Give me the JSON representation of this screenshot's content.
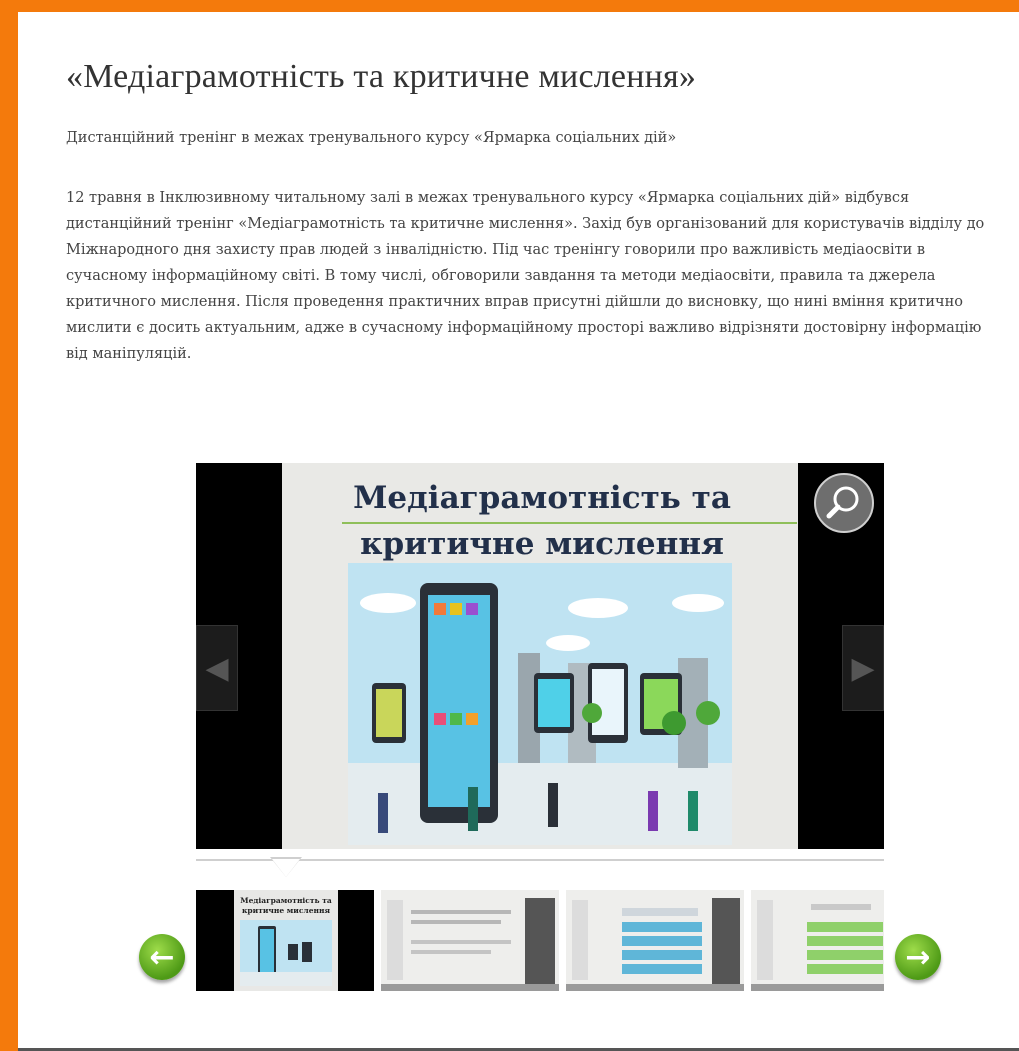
{
  "article": {
    "title": "«Медіаграмотність та критичне мислення»",
    "subtitle": "Дистанційний тренінг в межах тренувального курсу «Ярмарка соціальних дій»",
    "body": "12 травня в Інклюзивному читальному залі в межах тренувального курсу «Ярмарка соціальних дій» відбувся дистанційний тренінг «Медіаграмотність та критичне мислення». Захід був організований для користувачів відділу до Міжнародного дня захисту прав людей з інвалідністю. Під час тренінгу говорили про важливість медіаосвіти в сучасному інформаційному світі. В тому числі, обговорили завдання та методи медіаосвіти, правила та джерела критичного мислення. Після проведення практичних вправ присутні дійшли до висновку, що нині вміння критично мислити є досить актуальним, адже в сучасному інформаційному просторі важливо відрізняти достовірну інформацію від маніпуляцій."
  },
  "gallery": {
    "slide_title": "Медіаграмотність та критичне мислення",
    "prev_icon": "◀",
    "next_icon": "▶",
    "zoom_icon": "magnifier-icon",
    "thumb_active_title": "Медіаграмотність та критичне мислення",
    "thumb_prev_icon": "←",
    "thumb_next_icon": "→"
  },
  "colors": {
    "frame": "#f47a0c",
    "arrow_green": "#5aa81c",
    "slide_title": "#22304a"
  }
}
